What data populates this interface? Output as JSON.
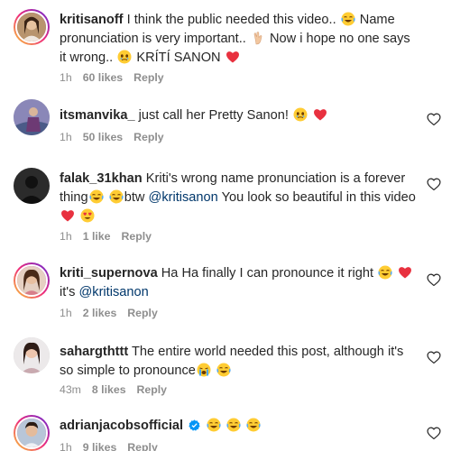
{
  "comments": [
    {
      "username": "kritisanoff",
      "text1": "I think the public needed this video..",
      "text2": "Name pronunciation is very important..",
      "text3": "Now i hope no one says it wrong..",
      "text4": "KRÍTÍ SANON",
      "time": "1h",
      "likes": "60 likes",
      "reply": "Reply"
    },
    {
      "username": "itsmanvika_",
      "text1": "just call her Pretty Sanon!",
      "time": "1h",
      "likes": "50 likes",
      "reply": "Reply"
    },
    {
      "username": "falak_31khan",
      "text1": "Kriti's wrong name pronunciation is a forever thing",
      "text2": "btw",
      "mention": "@kritisanon",
      "text3": "You look so beautiful in this video",
      "time": "1h",
      "likes": "1 like",
      "reply": "Reply"
    },
    {
      "username": "kriti_supernova",
      "text1": "Ha Ha finally I can pronounce it right",
      "text2": "it's",
      "mention": "@kritisanon",
      "time": "1h",
      "likes": "2 likes",
      "reply": "Reply"
    },
    {
      "username": "sahargthttt",
      "text1": "The entire world needed this post, although it's so simple to pronounce",
      "time": "43m",
      "likes": "8 likes",
      "reply": "Reply"
    },
    {
      "username": "adrianjacobsofficial",
      "time": "1h",
      "likes": "9 likes",
      "reply": "Reply"
    }
  ],
  "colors": {
    "text": "#262626",
    "secondary": "#8e8e8e",
    "mention": "#00376b",
    "heart_red": "#ed4956",
    "verified_blue": "#0095f6"
  },
  "icons": {
    "like": "heart-outline-icon",
    "laugh": "face-with-tears-of-joy-emoji",
    "red_heart": "red-heart-emoji",
    "skull": "skull-emoji",
    "heart_eyes": "smiling-face-with-heart-eyes-emoji",
    "crying": "loudly-crying-face-emoji",
    "hand": "pinching-hand-emoji",
    "verified": "verified-badge-icon"
  }
}
